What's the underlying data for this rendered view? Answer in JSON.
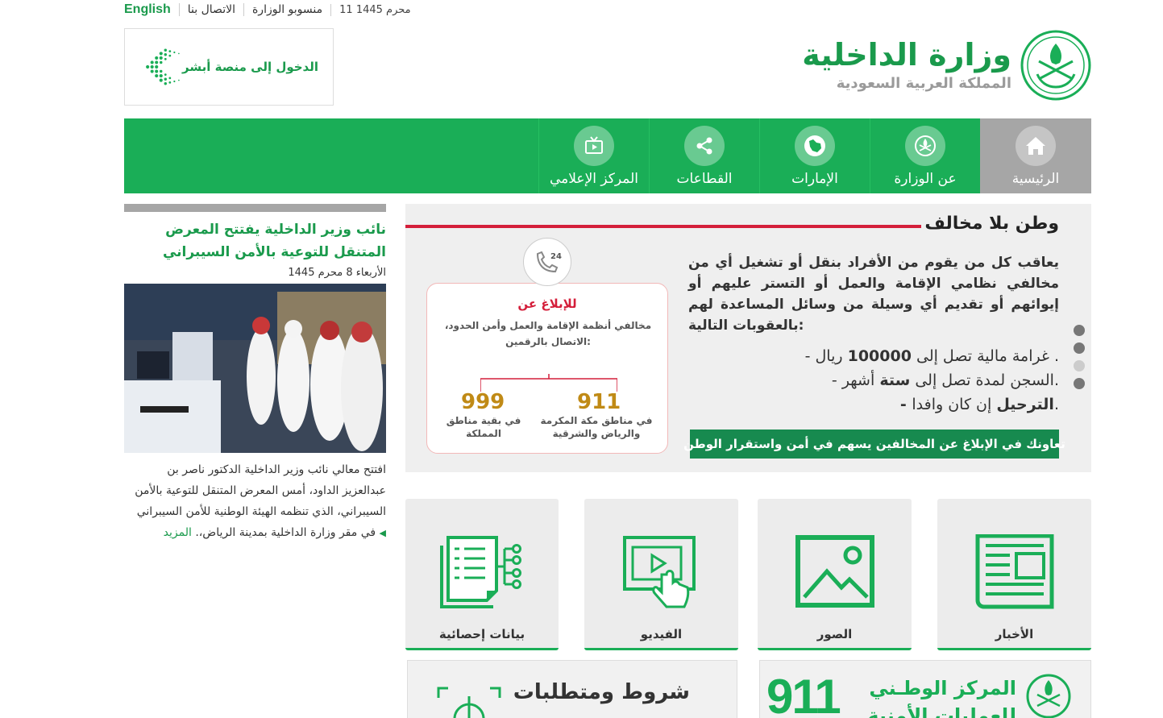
{
  "topbar": {
    "english": "English",
    "contact": "الاتصال بنا",
    "staff": "منسوبو الوزارة",
    "date": "11 محرم 1445"
  },
  "absher": {
    "label": "الدخول إلى منصة أبشر"
  },
  "logo": {
    "title": "وزارة الداخلية",
    "subtitle": "المملكة العربية السعودية"
  },
  "nav": {
    "items": [
      {
        "label": "الرئيسية",
        "icon": "home-icon",
        "active": true
      },
      {
        "label": "عن الوزارة",
        "icon": "emblem-icon"
      },
      {
        "label": "الإمارات",
        "icon": "map-icon"
      },
      {
        "label": "القطاعات",
        "icon": "share-icon"
      },
      {
        "label": "المركز الإعلامي",
        "icon": "tv-icon"
      }
    ]
  },
  "news": {
    "title": "نائب وزير الداخلية يفتتح المعرض المتنقل للتوعية بالأمن السيبراني",
    "date": "الأربعاء 8 محرم 1445",
    "body": "افتتح معالي نائب وزير الداخلية الدكتور ناصر بن عبدالعزيز الداود، أمس المعرض المتنقل للتوعية بالأمن السيبراني، الذي تنظمه الهيئة الوطنية للأمن السيبراني في مقر وزارة الداخلية بمدينة الرياض،.",
    "more": "المزيد"
  },
  "banner": {
    "title": "وطن بلا مخالف",
    "paragraph": "يعاقب كل من يقوم من الأفراد بنقل أو تشغيل أي من مخالفي نظامي الإقامة والعمل أو التستر عليهم أو إيوائهم أو تقديم أي وسيلة من وسائل المساعدة لهم بالعقوبات التالية:",
    "bullet1_pre": "- غرامة مالية تصل إلى",
    "bullet1_num": "100000",
    "bullet1_post": "ريال .",
    "bullet2_pre": "- السجن لمدة تصل إلى",
    "bullet2_bold": "ستة",
    "bullet2_post": "أشهر.",
    "bullet3_bold": "- الترحيل",
    "bullet3_post": "إن كان وافدا.",
    "strip": "تعاونك في الإبلاغ عن المخالفين يسهم في أمن واستقرار الوطن",
    "card_title": "للإبلاغ عن",
    "card_text": "مخالفي أنظمة الإقامة والعمل وأمن الحدود، الاتصال بالرقمين:",
    "phone_badge": "24",
    "num1": "911",
    "num1_label": "في مناطق مكة المكرمة والرياض والشرقية",
    "num2": "999",
    "num2_label": "في بقية مناطق المملكة"
  },
  "tiles": [
    {
      "label": "الأخبار",
      "icon": "newspaper-icon"
    },
    {
      "label": "الصور",
      "icon": "image-icon"
    },
    {
      "label": "الفيديو",
      "icon": "video-icon"
    },
    {
      "label": "بيانات إحصائية",
      "icon": "statistics-icon"
    }
  ],
  "promos": {
    "security_ops": "المركز الوطـني",
    "security_ops_line2": "للعمليات الأمنية",
    "number": "911",
    "conditions": "شروط ومتطلبات"
  },
  "colors": {
    "green": "#1aae57",
    "dark_green": "#178a4f",
    "red": "#d41e3a",
    "gray": "#a6a6a6"
  }
}
